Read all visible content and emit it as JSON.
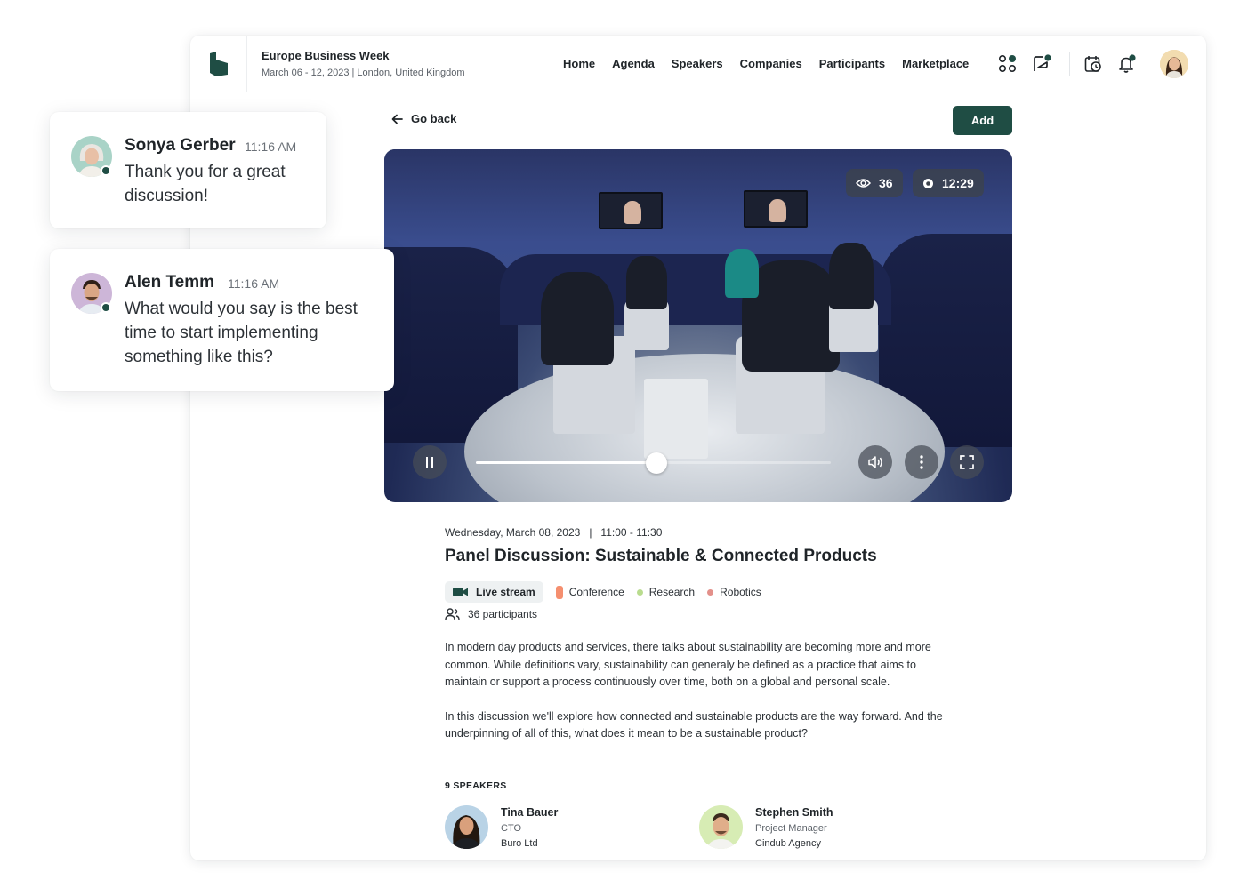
{
  "header": {
    "event_title": "Europe Business Week",
    "event_subtitle": "March 06 - 12, 2023 | London, United Kingdom",
    "nav": [
      "Home",
      "Agenda",
      "Speakers",
      "Companies",
      "Participants",
      "Marketplace"
    ],
    "icons": [
      "apps-icon",
      "chat-icon",
      "calendar-icon",
      "bell-icon"
    ],
    "accent_color": "#1f4d44"
  },
  "toolbar": {
    "go_back_label": "Go back",
    "add_label": "Add"
  },
  "video": {
    "viewers": "36",
    "duration": "12:29",
    "progress": 0.51
  },
  "session": {
    "date_time": "Wednesday, March 08, 2023   |   11:00 - 11:30",
    "title": "Panel Discussion: Sustainable & Connected Products",
    "tags": {
      "live": "Live stream",
      "conference": "Conference",
      "research": "Research",
      "robotics": "Robotics"
    },
    "tag_colors": {
      "conference": "#f58f6f",
      "research": "#b9dc8e",
      "robotics": "#e3908a"
    },
    "participants": "36 participants",
    "description": [
      "In modern day products and services, there talks about sustainability are becoming more and more common. While definitions vary, sustainability can generaly be defined as a practice that aims to maintain or support a process continuously over time, both on a global and personal scale.",
      "In this discussion we'll explore how connected and sustainable products are the way forward. And the underpinning of all of this, what does it mean to be a sustainable product?"
    ],
    "speakers_heading": "9 SPEAKERS",
    "speakers": [
      {
        "name": "Tina Bauer",
        "role": "CTO",
        "company": "Buro Ltd"
      },
      {
        "name": "Stephen Smith",
        "role": "Project Manager",
        "company": "Cindub Agency"
      }
    ]
  },
  "chats": [
    {
      "name": "Sonya Gerber",
      "time": "11:16 AM",
      "message_lines": [
        "Thank you for a great",
        "discussion!"
      ]
    },
    {
      "name": "Alen Temm",
      "time": "11:16 AM",
      "message_lines": [
        "What would you say is the best",
        "time to start implementing",
        "something like this?"
      ]
    }
  ]
}
